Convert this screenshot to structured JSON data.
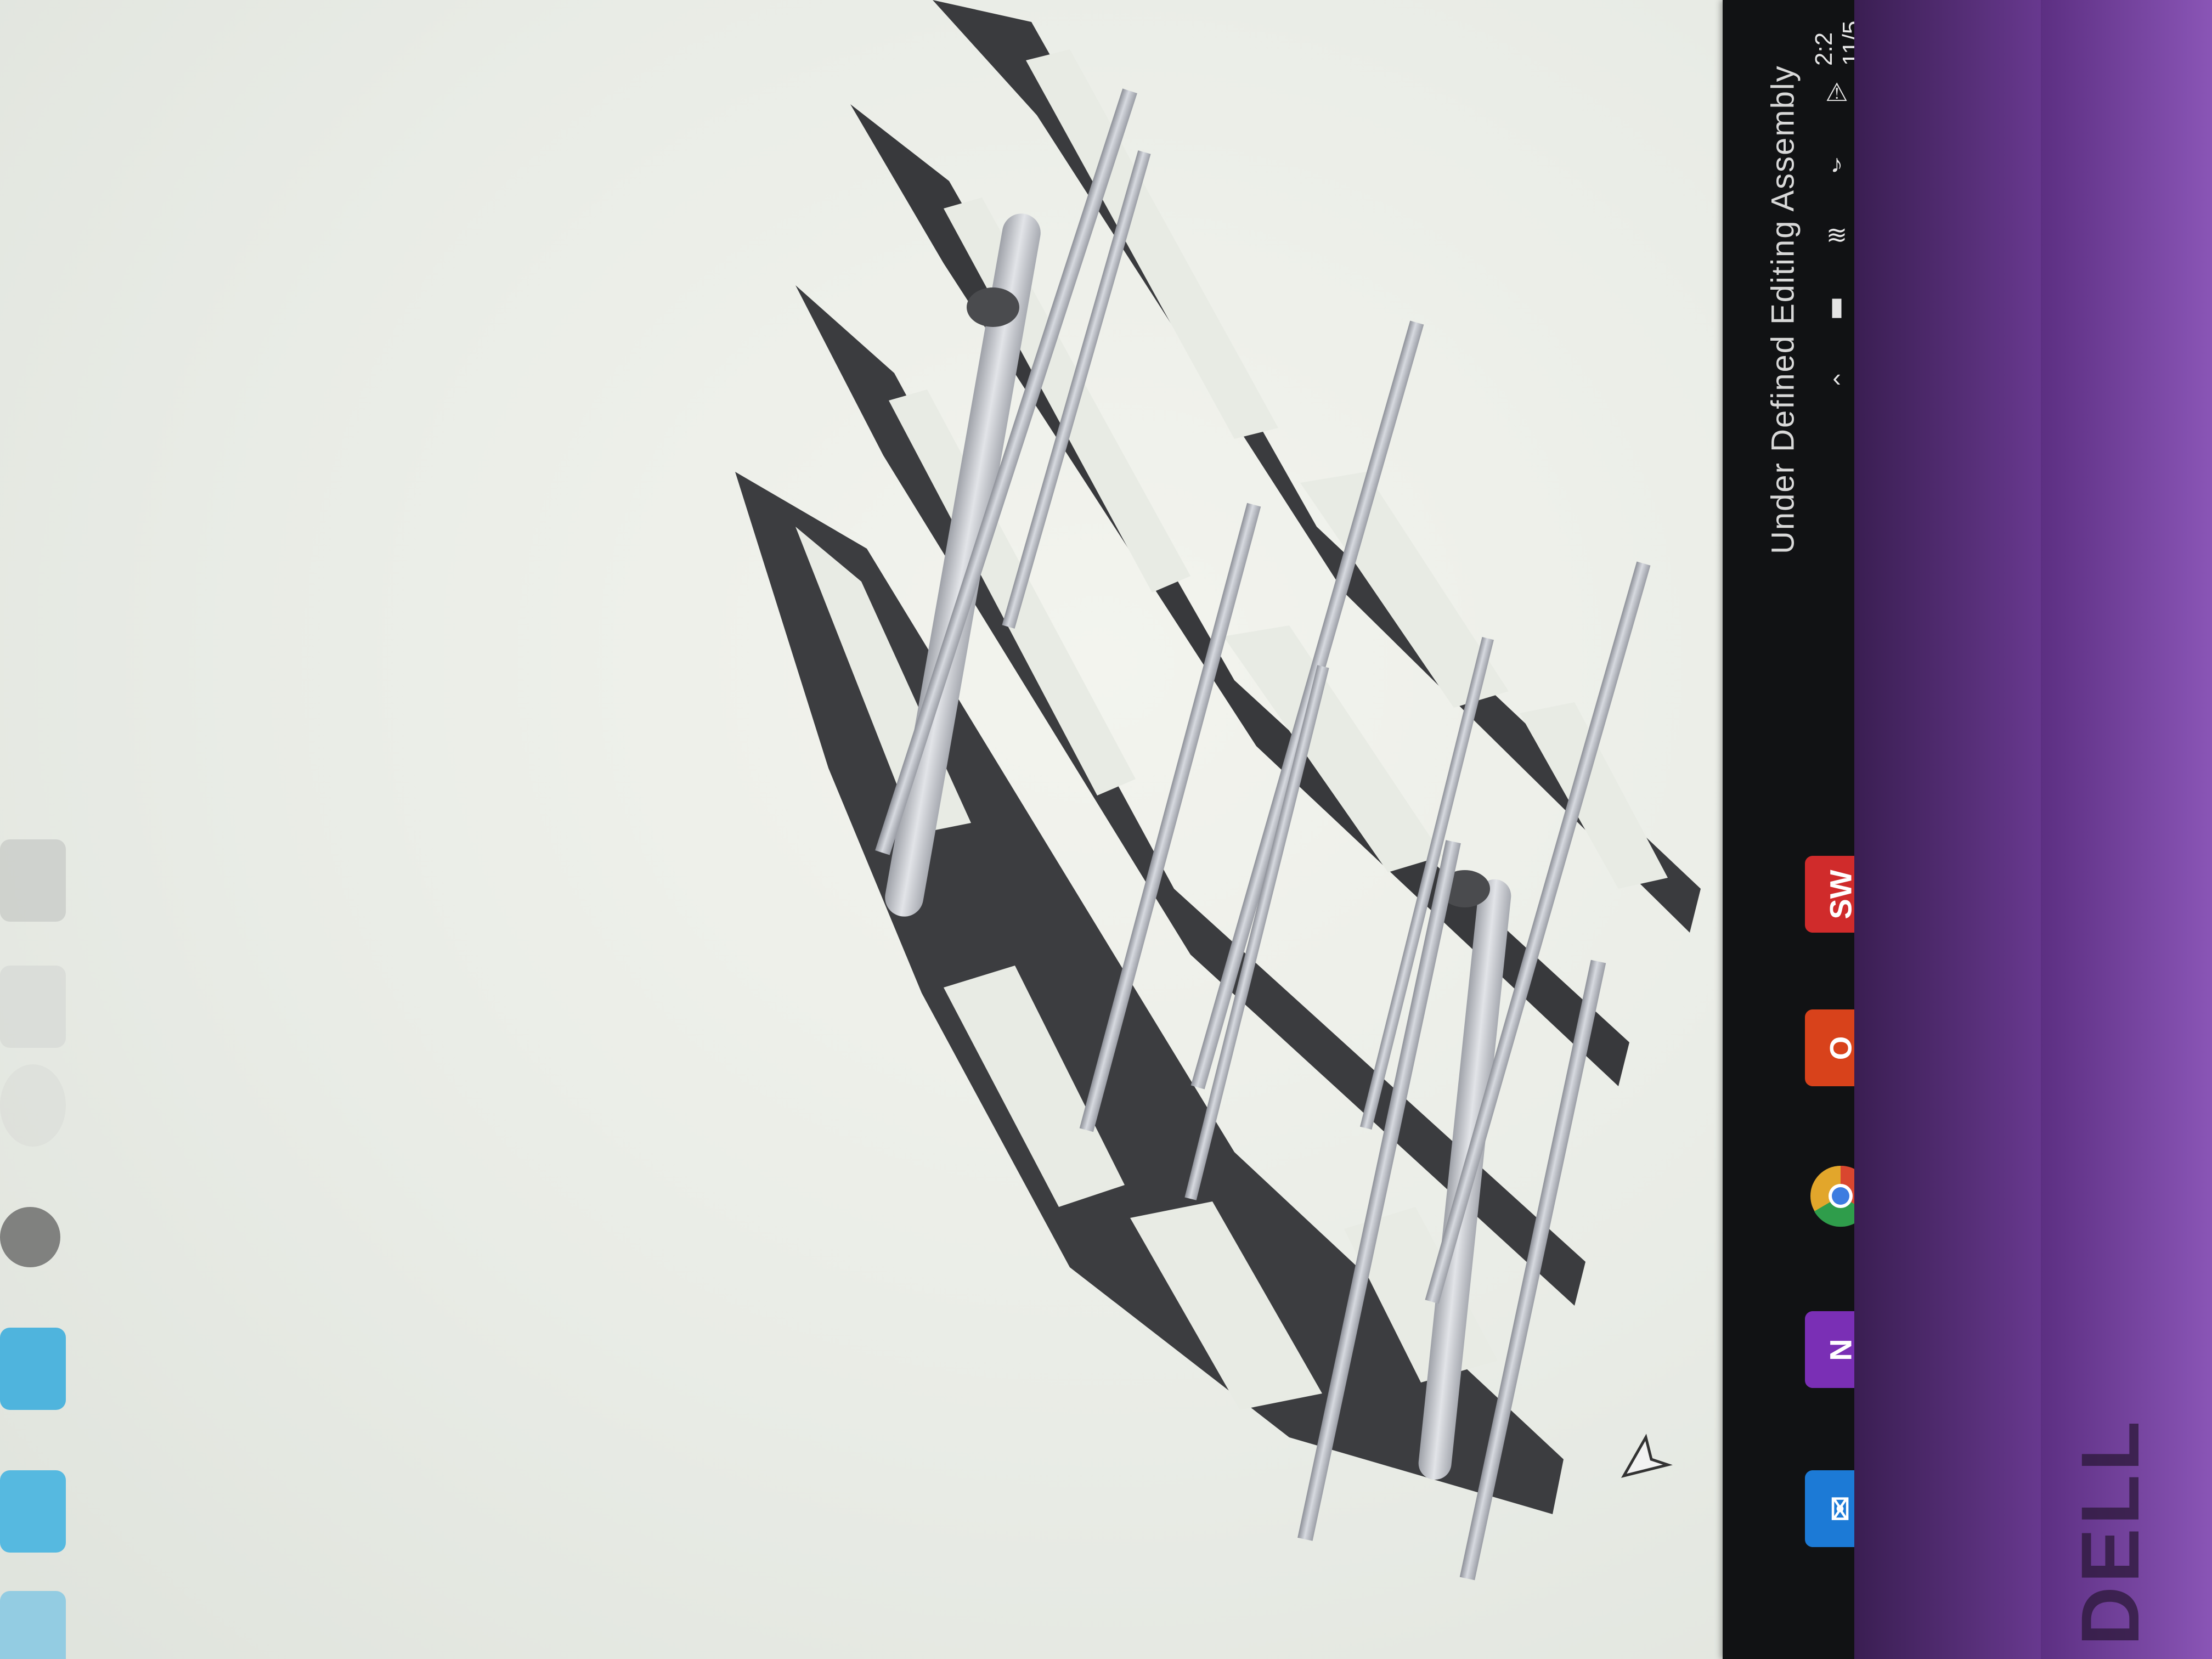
{
  "window": {
    "status": "Under Defined   Editing Assembly"
  },
  "clock": {
    "time": "2:2",
    "date": "11/5"
  },
  "taskbar": {
    "apps": [
      {
        "name": "SolidWorks",
        "glyph": "SW",
        "color": "#d02b2b"
      },
      {
        "name": "Office",
        "glyph": "O",
        "color": "#d8421b"
      },
      {
        "name": "Chrome",
        "glyph": "●",
        "color": "#e2a62b"
      },
      {
        "name": "OneNote",
        "glyph": "N",
        "color": "#7a2fb5"
      },
      {
        "name": "Mail",
        "glyph": "✉",
        "color": "#1c7ad6"
      }
    ],
    "tray_icons": [
      "chevron-up-icon",
      "battery-icon",
      "wifi-icon",
      "volume-icon",
      "warning-icon"
    ]
  },
  "toolbar": {
    "tools": [
      "fixture-icon",
      "mesh-icon",
      "sphere-icon",
      "mate-icon",
      "cube-icon",
      "box-icon",
      "axis-icon"
    ]
  },
  "device": {
    "brand": "DELL"
  },
  "colors": {
    "model_dark": "#3c3d40",
    "model_rod": "#b9bcc4",
    "taskbar": "#111214",
    "accent": "#7cc3ff"
  }
}
